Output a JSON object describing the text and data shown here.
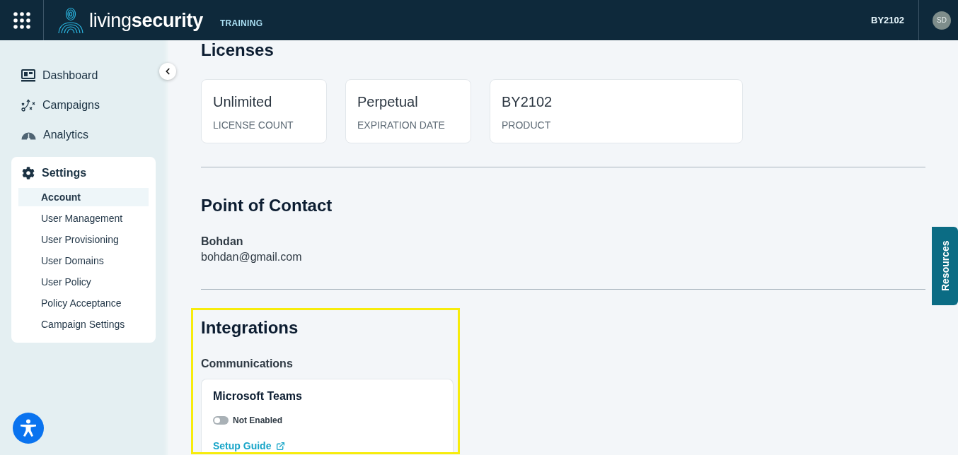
{
  "header": {
    "logo_text": "living**security**",
    "product_label": "TRAINING",
    "account_code": "BY2102",
    "avatar_initials": "SD"
  },
  "sidebar": {
    "items": [
      {
        "label": "Dashboard",
        "kind": "dashboard",
        "selected": false
      },
      {
        "label": "Campaigns",
        "kind": "campaigns",
        "selected": false
      },
      {
        "label": "Analytics",
        "kind": "analytics",
        "selected": false
      },
      {
        "label": "Settings",
        "kind": "settings",
        "selected": true,
        "expanded": true,
        "children": [
          {
            "label": "Account",
            "selected": true
          },
          {
            "label": "User Management",
            "selected": false
          },
          {
            "label": "User Provisioning",
            "selected": false
          },
          {
            "label": "User Domains",
            "selected": false
          },
          {
            "label": "User Policy",
            "selected": false
          },
          {
            "label": "Policy Acceptance",
            "selected": false
          },
          {
            "label": "Campaign Settings",
            "selected": false
          }
        ]
      }
    ]
  },
  "licenses": {
    "title": "Licenses",
    "cards": [
      {
        "value": "Unlimited",
        "label": "LICENSE COUNT"
      },
      {
        "value": "Perpetual",
        "label": "EXPIRATION DATE"
      },
      {
        "value": "BY2102",
        "label": "PRODUCT"
      }
    ]
  },
  "point_of_contact": {
    "title": "Point of Contact",
    "name": "Bohdan",
    "email": "bohdan@gmail.com"
  },
  "integrations": {
    "title": "Integrations",
    "highlighted": true,
    "groups": [
      {
        "title": "Communications",
        "items": [
          {
            "name": "Microsoft Teams",
            "enabled": false,
            "status": "Not Enabled",
            "link": "Setup Guide"
          }
        ]
      }
    ]
  },
  "resources_tab": {
    "label": "Resources"
  }
}
